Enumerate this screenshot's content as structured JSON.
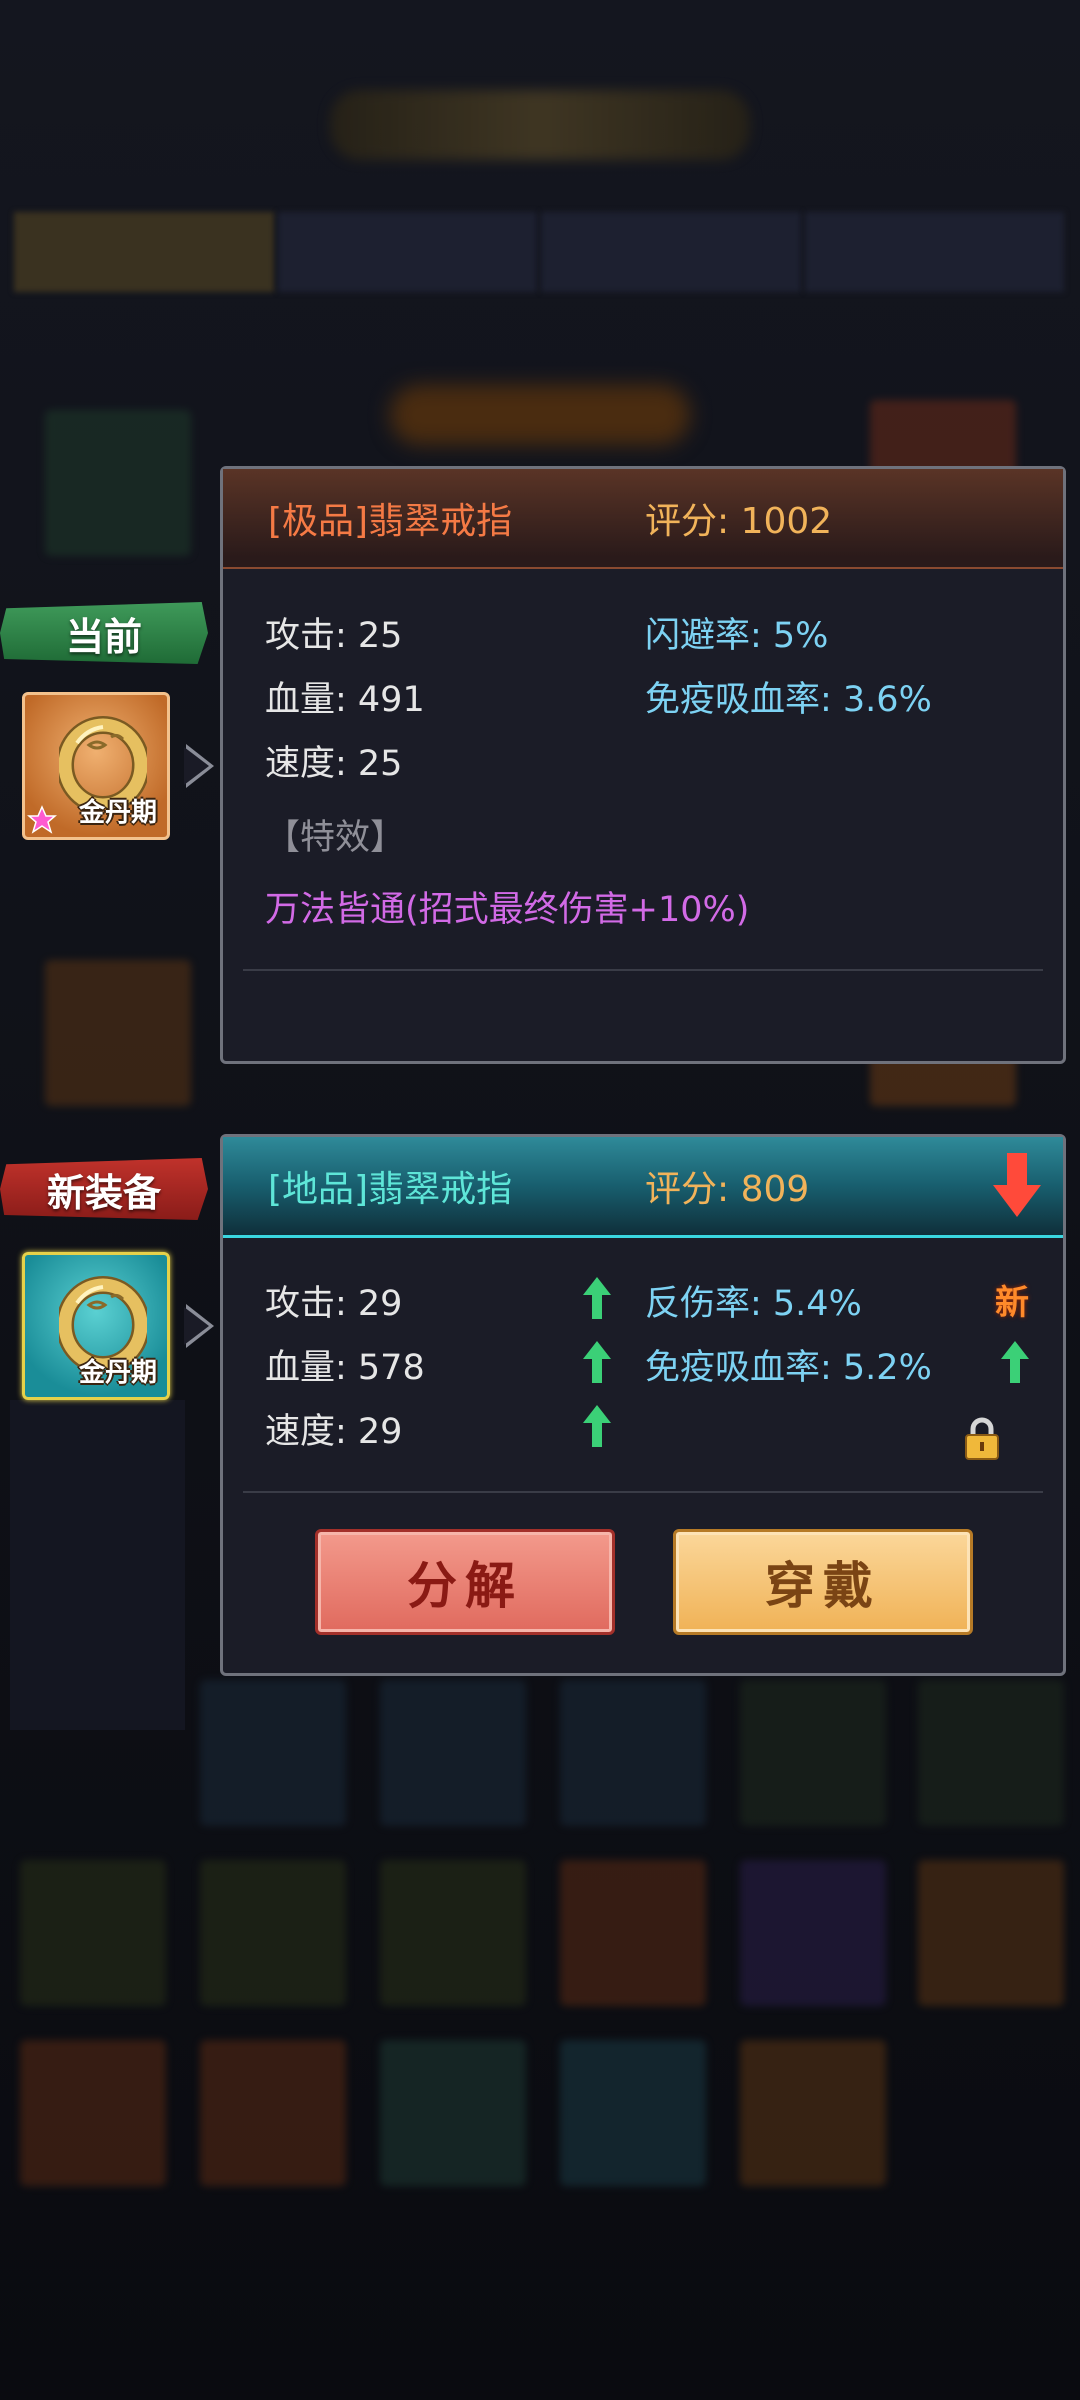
{
  "labels": {
    "current": "当前",
    "new": "新装备"
  },
  "current_item": {
    "realm": "金丹期",
    "name": "[极品]翡翠戒指",
    "score": "评分: 1002",
    "stats": [
      "攻击: 25",
      "血量: 491",
      "速度: 25"
    ],
    "extra_stats": [
      "闪避率: 5%",
      "免疫吸血率: 3.6%"
    ],
    "effect_title": "【特效】",
    "effect": "万法皆通(招式最终伤害+10%)"
  },
  "new_item": {
    "realm": "金丹期",
    "name": "[地品]翡翠戒指",
    "score": "评分: 809",
    "stats": [
      "攻击: 29",
      "血量: 578",
      "速度: 29"
    ],
    "extra_stats": [
      "反伤率: 5.4%",
      "免疫吸血率: 5.2%"
    ],
    "new_badge": "新",
    "buttons": {
      "decompose": "分解",
      "equip": "穿戴"
    }
  },
  "colors": {
    "up_arrow": "#3bd077",
    "score": "#f1b35a",
    "down_arrow": "#ff4a3a"
  },
  "icons": [
    "ring-icon",
    "star-icon",
    "up-arrow-icon",
    "down-arrow-icon",
    "lock-icon"
  ]
}
